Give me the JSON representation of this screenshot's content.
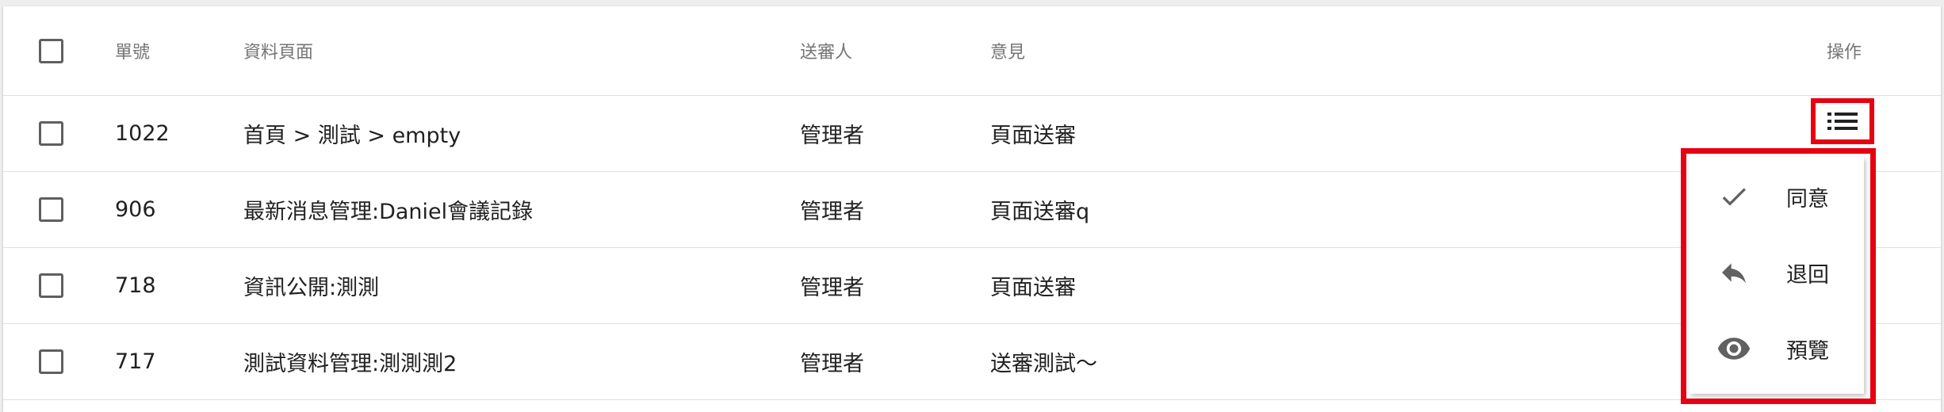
{
  "table": {
    "headers": {
      "id": "單號",
      "page": "資料頁面",
      "sender": "送審人",
      "comment": "意見",
      "action": "操作"
    },
    "rows": [
      {
        "id": "1022",
        "page": "首頁 > 測試 > empty",
        "sender": "管理者",
        "comment": "頁面送審"
      },
      {
        "id": "906",
        "page": "最新消息管理:Daniel會議記錄",
        "sender": "管理者",
        "comment": "頁面送審q"
      },
      {
        "id": "718",
        "page": "資訊公開:測測",
        "sender": "管理者",
        "comment": "頁面送審"
      },
      {
        "id": "717",
        "page": "測試資料管理:測測測2",
        "sender": "管理者",
        "comment": "送審測試～"
      }
    ]
  },
  "action_menu": {
    "items": [
      {
        "label": "同意",
        "icon": "check-icon"
      },
      {
        "label": "退回",
        "icon": "reply-icon"
      },
      {
        "label": "預覽",
        "icon": "eye-icon"
      }
    ]
  },
  "colors": {
    "highlight": "#e60012",
    "icon": "#616161"
  }
}
